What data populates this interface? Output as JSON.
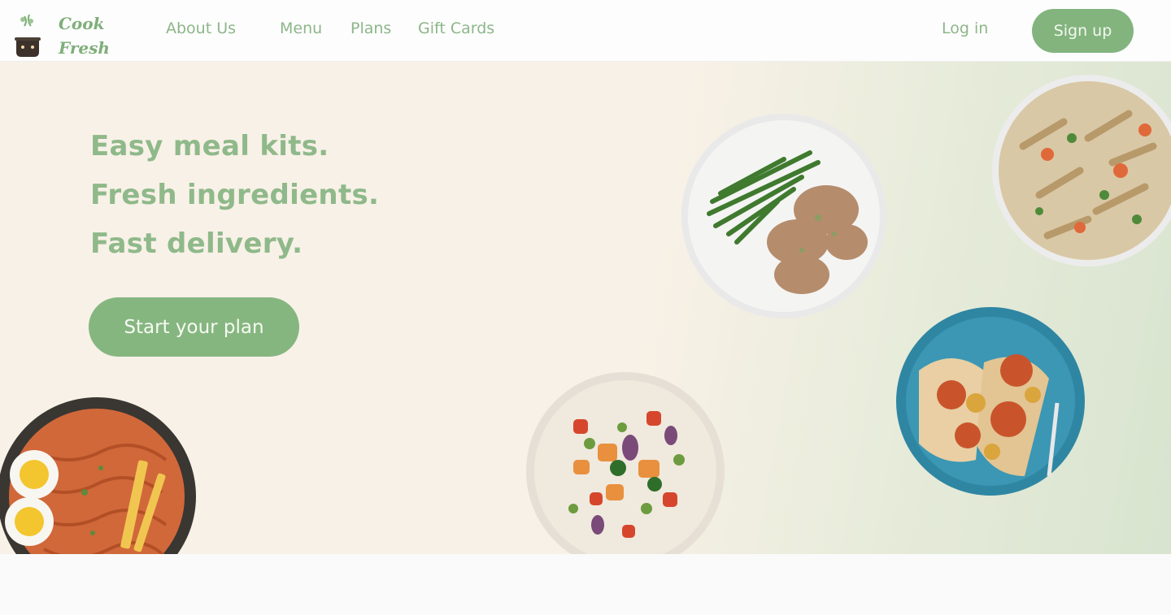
{
  "brand": {
    "name_line1": "Cook",
    "name_line2": "Fresh",
    "logo_icon": "cooking-pot-icon"
  },
  "nav": {
    "links": [
      "About Us",
      "Menu",
      "Plans",
      "Gift Cards"
    ],
    "login": "Log in",
    "signup": "Sign up"
  },
  "hero": {
    "headlines": [
      "Easy meal kits.",
      "Fresh ingredients.",
      "Fast delivery."
    ],
    "cta": "Start your plan"
  },
  "colors": {
    "accent": "#83b47e",
    "hero_bg_left": "#f8f1e7",
    "hero_bg_right": "#d8e4cf",
    "nav_bg": "#fdfdfd"
  },
  "dishes": [
    "green-beans-chicken-plate",
    "pasta-primavera-bowl",
    "bruschetta-toast-plate",
    "roasted-vegetable-salad-bowl",
    "noodle-egg-pan"
  ]
}
